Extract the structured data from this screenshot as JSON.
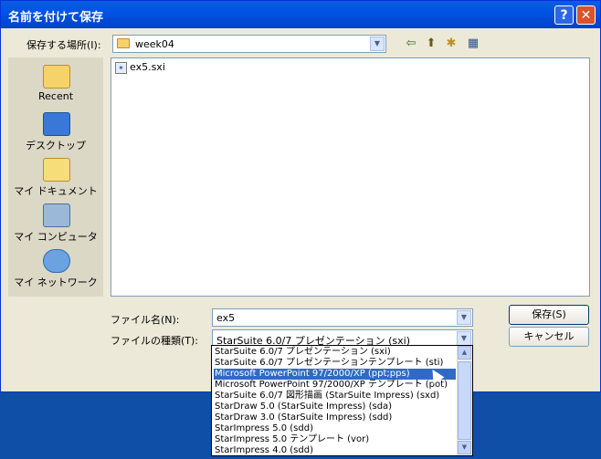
{
  "window": {
    "title": "名前を付けて保存",
    "help_label": "?",
    "close_label": "✕"
  },
  "save_in": {
    "label": "保存する場所(I):",
    "value": "week04"
  },
  "places": [
    {
      "label": "Recent",
      "icon": "recent-folder-icon"
    },
    {
      "label": "デスクトップ",
      "icon": "desktop-icon"
    },
    {
      "label": "マイ ドキュメント",
      "icon": "my-documents-icon"
    },
    {
      "label": "マイ コンピュータ",
      "icon": "my-computer-icon"
    },
    {
      "label": "マイ ネットワーク",
      "icon": "my-network-icon"
    }
  ],
  "files": [
    {
      "name": "ex5.sxi"
    }
  ],
  "filename": {
    "label": "ファイル名(N):",
    "value": "ex5"
  },
  "filetype": {
    "label": "ファイルの種類(T):",
    "value": "StarSuite 6.0/7 プレゼンテーション (sxi)",
    "options": [
      "StarSuite 6.0/7 プレゼンテーション (sxi)",
      "StarSuite 6.0/7 プレゼンテーションテンプレート (sti)",
      "Microsoft PowerPoint 97/2000/XP (ppt;pps)",
      "Microsoft PowerPoint 97/2000/XP テンプレート (pot)",
      "StarSuite 6.0/7 図形描画 (StarSuite Impress) (sxd)",
      "StarDraw 5.0 (StarSuite Impress) (sda)",
      "StarDraw 3.0 (StarSuite Impress) (sdd)",
      "StarImpress 5.0 (sdd)",
      "StarImpress 5.0 テンプレート (vor)",
      "StarImpress 4.0 (sdd)"
    ],
    "highlighted_index": 2
  },
  "buttons": {
    "save": "保存(S)",
    "cancel": "キャンセル"
  },
  "colors": {
    "titlebar": "#0054e3",
    "selection": "#316ac5",
    "dialog_bg": "#ece9d8"
  }
}
